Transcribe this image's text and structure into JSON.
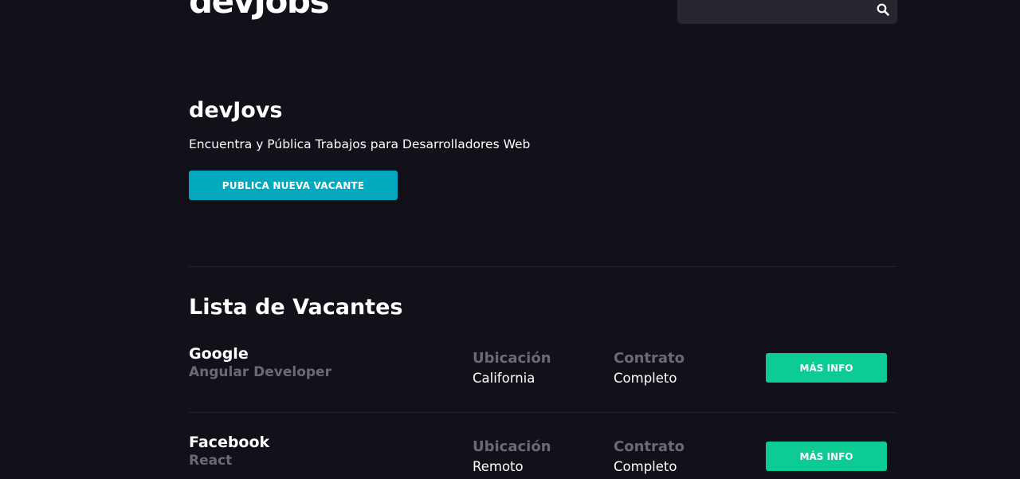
{
  "header": {
    "logo": "devJobs",
    "search": {
      "placeholder": "",
      "value": "",
      "icon": "search-icon"
    }
  },
  "hero": {
    "title": "devJovs",
    "subtitle": "Encuentra y Pública Trabajos para Desarrolladores Web",
    "publish_button": "PUBLICA NUEVA VACANTE"
  },
  "jobs_section": {
    "title": "Lista de Vacantes",
    "location_label": "Ubicación",
    "contract_label": "Contrato",
    "items": [
      {
        "company": "Google",
        "role": "Angular Developer",
        "location": "California",
        "contract": "Completo",
        "button": "MÁS INFO"
      },
      {
        "company": "Facebook",
        "role": "React",
        "location": "Remoto",
        "contract": "Completo",
        "button": "MÁS INFO"
      }
    ]
  },
  "colors": {
    "background": "#12111a",
    "primary_button": "#02a8bd",
    "info_button": "#0ccb93",
    "muted_text": "#6b6a72",
    "search_bg": "#27262f"
  }
}
